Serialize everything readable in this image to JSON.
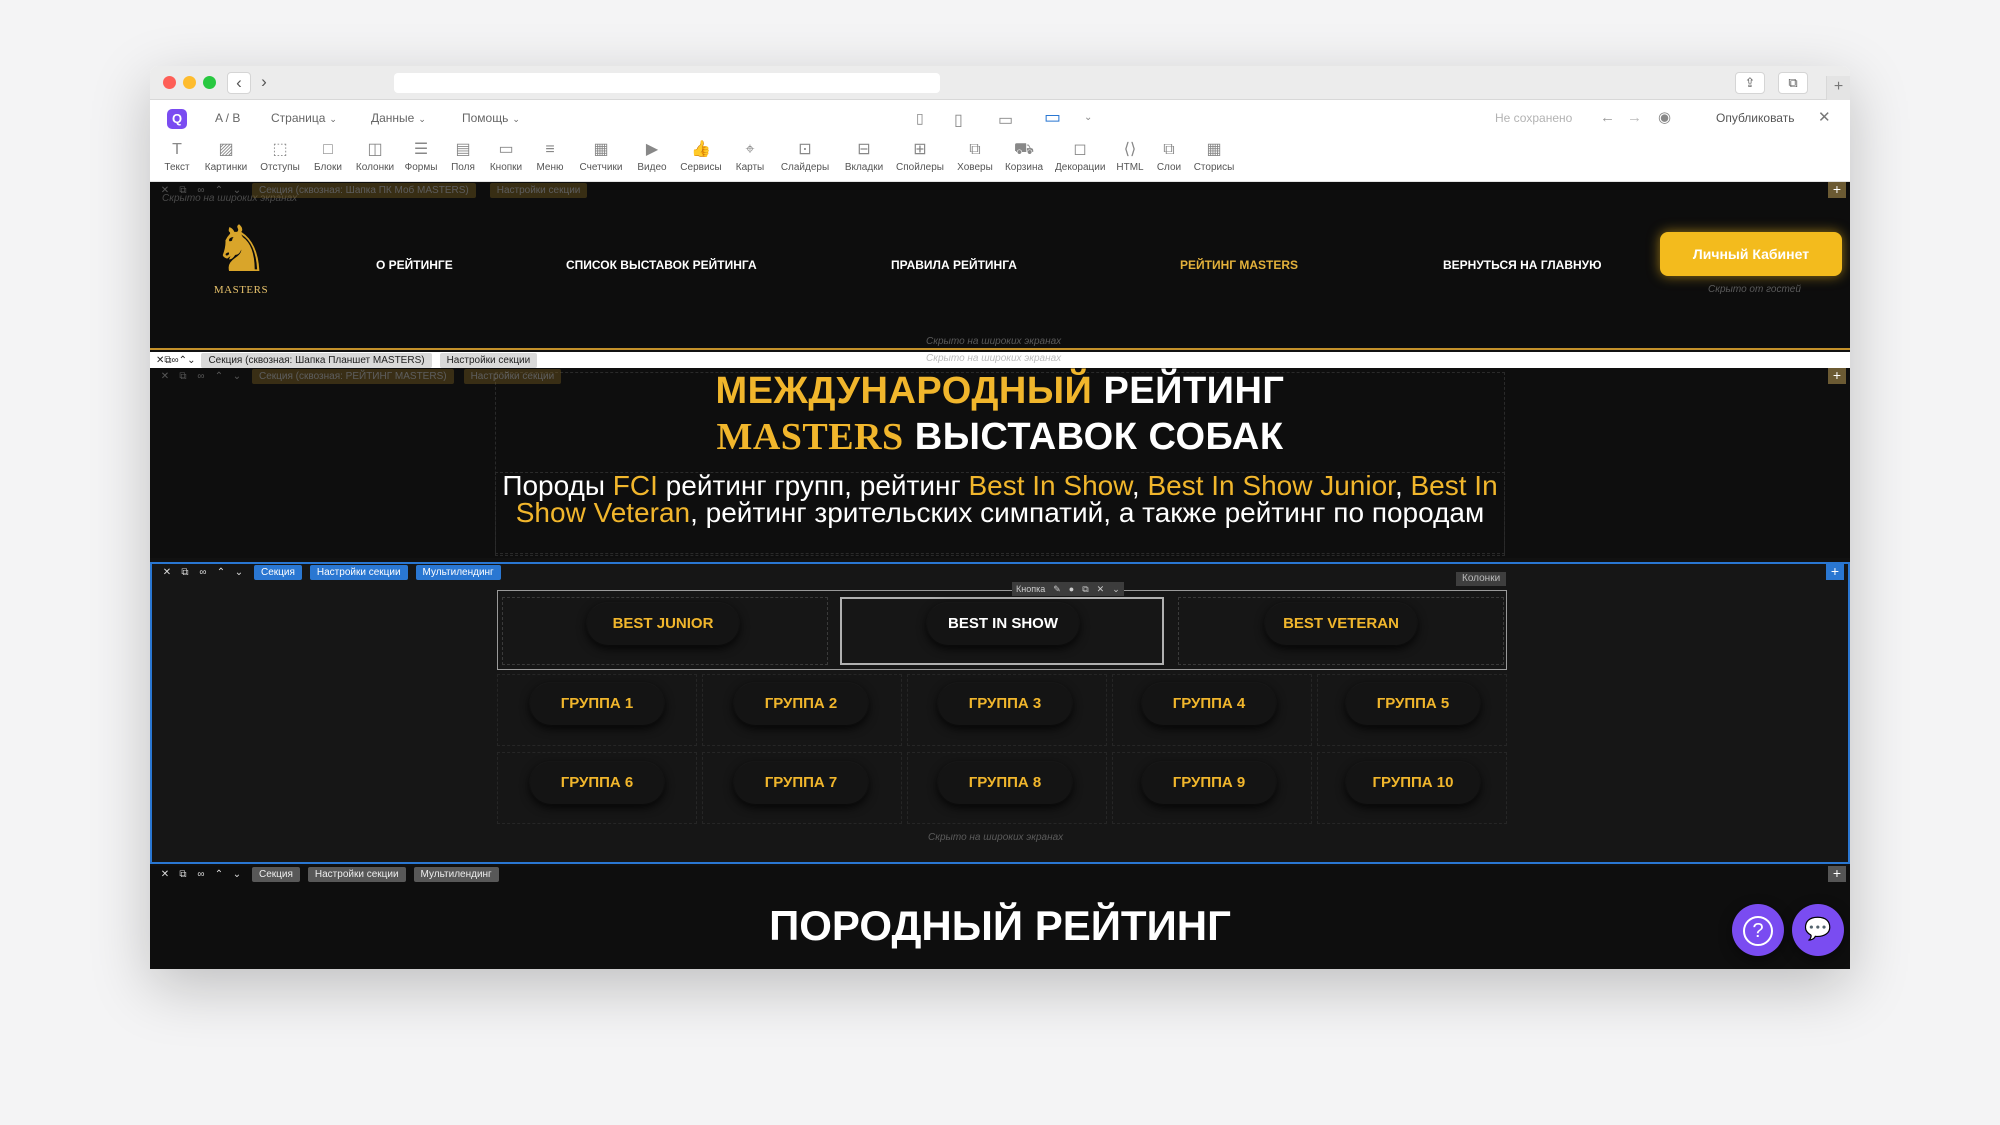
{
  "editor": {
    "ab": "A / B",
    "menu": [
      "Страница",
      "Данные",
      "Помощь"
    ],
    "status": "Не сохранено",
    "publish": "Опубликовать"
  },
  "widgets": [
    "Текст",
    "Картинки",
    "Отступы",
    "Блоки",
    "Колонки",
    "Формы",
    "Поля",
    "Кнопки",
    "Меню",
    "Счетчики",
    "Видео",
    "Сервисы",
    "Карты",
    "Слайдеры",
    "Вкладки",
    "Спойлеры",
    "Ховеры",
    "Корзина",
    "Декорации",
    "HTML",
    "Слои",
    "Сторисы"
  ],
  "notes": {
    "hidden_wide": "Скрыто на широких экранах",
    "hidden_guests": "Скрыто от гостей"
  },
  "sections": {
    "s1": "Секция (сквозная: Шапка ПК Моб MASTERS)",
    "s2": "Секция (сквозная: Шапка Планшет MASTERS)",
    "s3": "Секция (сквозная: РЕЙТИНГ MASTERS)",
    "s4": "Секция",
    "s5": "Секция",
    "settings": "Настройки секции",
    "multi": "Мультилендинг",
    "button_tag": "Кнопка",
    "columns_tag": "Колонки"
  },
  "header": {
    "logo_text": "MASTERS",
    "nav": [
      "О рейтинге",
      "Список выставок рейтинга",
      "Правила рейтинга",
      "Рейтинг MASTERS",
      "Вернуться на главную"
    ],
    "cabinet": "Личный Кабинет"
  },
  "hero": {
    "line1_gold": "МЕЖДУНАРОДНЫЙ",
    "line1_white": "РЕЙТИНГ",
    "line2_gold": "MASTERS",
    "line2_white": "ВЫСТАВОК СОБАК",
    "sub": [
      {
        "t": "Породы ",
        "gold": false
      },
      {
        "t": "FCI",
        "gold": true
      },
      {
        "t": " рейтинг групп, рейтинг ",
        "gold": false
      },
      {
        "t": "Best In Show",
        "gold": true
      },
      {
        "t": ", ",
        "gold": false
      },
      {
        "t": "Best In Show Junior",
        "gold": true
      },
      {
        "t": ", ",
        "gold": false
      },
      {
        "t": "Best In Show Veteran",
        "gold": true
      },
      {
        "t": ", рейтинг зрительских симпатий, а также рейтинг по породам",
        "gold": false
      }
    ]
  },
  "buttons": {
    "top": [
      "Best Junior",
      "Best In Show",
      "Best Veteran"
    ],
    "groups_row1": [
      "Группа 1",
      "Группа 2",
      "Группа 3",
      "Группа 4",
      "Группа 5"
    ],
    "groups_row2": [
      "Группа 6",
      "Группа 7",
      "Группа 8",
      "Группа 9",
      "Группа 10"
    ]
  },
  "breed": {
    "title": "ПОРОДНЫЙ РЕЙТИНГ"
  },
  "colors": {
    "gold": "#f1b62c",
    "accent_purple": "#7a4cf1",
    "selection_blue": "#2a77d2"
  }
}
